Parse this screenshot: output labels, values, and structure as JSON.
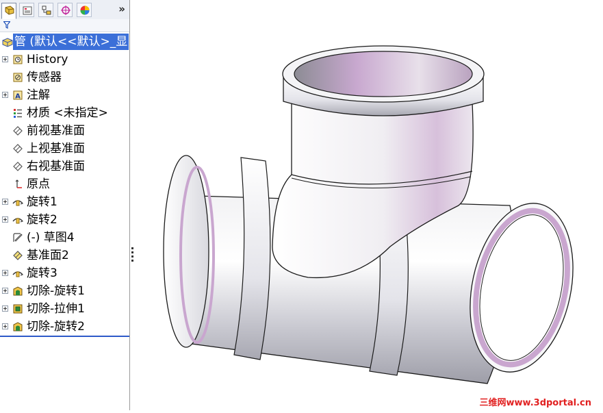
{
  "tabs": [
    {
      "name": "featuremanager"
    },
    {
      "name": "propertymanager"
    },
    {
      "name": "configurationmanager"
    },
    {
      "name": "dimxpertmanager"
    },
    {
      "name": "displaymanager"
    }
  ],
  "overflow_glyph": "»",
  "tree": {
    "root": {
      "label": "管  (默认<<默认>_显",
      "icon": "part-icon"
    },
    "items": [
      {
        "label": "History",
        "icon": "history-icon",
        "expandable": true
      },
      {
        "label": "传感器",
        "icon": "sensor-icon",
        "expandable": false
      },
      {
        "label": "注解",
        "icon": "annotation-icon",
        "expandable": true
      },
      {
        "label": "材质 <未指定>",
        "icon": "material-icon",
        "expandable": false
      },
      {
        "label": "前视基准面",
        "icon": "plane-icon",
        "expandable": false
      },
      {
        "label": "上视基准面",
        "icon": "plane-icon",
        "expandable": false
      },
      {
        "label": "右视基准面",
        "icon": "plane-icon",
        "expandable": false
      },
      {
        "label": "原点",
        "icon": "origin-icon",
        "expandable": false
      },
      {
        "label": "旋转1",
        "icon": "revolve-icon",
        "expandable": true
      },
      {
        "label": "旋转2",
        "icon": "revolve-icon",
        "expandable": true
      },
      {
        "label": "(-) 草图4",
        "icon": "sketch-icon",
        "expandable": false
      },
      {
        "label": "基准面2",
        "icon": "plane-icon",
        "expandable": false
      },
      {
        "label": "旋转3",
        "icon": "revolve-icon",
        "expandable": true
      },
      {
        "label": "切除-旋转1",
        "icon": "cut-revolve-icon",
        "expandable": true
      },
      {
        "label": "切除-拉伸1",
        "icon": "cut-extrude-icon",
        "expandable": true
      },
      {
        "label": "切除-旋转2",
        "icon": "cut-revolve-icon",
        "expandable": true
      }
    ]
  },
  "watermark": "三维网www.3dportal.cn",
  "colors": {
    "selection": "#3b6fd8",
    "pipe_inner": "#c9a6cf",
    "watermark": "#e12020"
  }
}
